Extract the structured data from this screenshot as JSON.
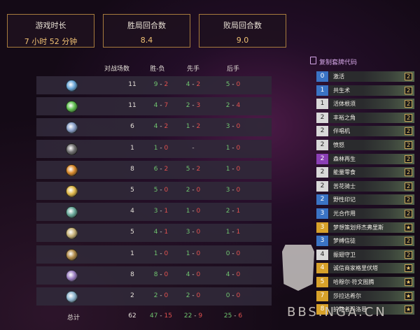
{
  "stats": [
    {
      "label": "游戏时长",
      "value": "7 小时 52 分钟"
    },
    {
      "label": "胜局回合数",
      "value": "8.4"
    },
    {
      "label": "败局回合数",
      "value": "9.0"
    }
  ],
  "table": {
    "headers": [
      "对战场数",
      "胜-负",
      "先手",
      "后手"
    ],
    "rows": [
      {
        "icon": "mage-class-icon",
        "color": "#6aa7d8",
        "games": "11",
        "wl": [
          "9",
          "2"
        ],
        "first": [
          "4",
          "2"
        ],
        "second": [
          "5",
          "0"
        ]
      },
      {
        "icon": "hunter-class-icon",
        "color": "#5fbf4f",
        "games": "11",
        "wl": [
          "4",
          "7"
        ],
        "first": [
          "2",
          "3"
        ],
        "second": [
          "2",
          "4"
        ]
      },
      {
        "icon": "shaman-class-icon",
        "color": "#8aa0c9",
        "games": "6",
        "wl": [
          "4",
          "2"
        ],
        "first": [
          "1",
          "2"
        ],
        "second": [
          "3",
          "0"
        ]
      },
      {
        "icon": "rogue-class-icon",
        "color": "#707070",
        "games": "1",
        "wl": [
          "1",
          "0"
        ],
        "first": [
          "-"
        ],
        "second": [
          "1",
          "0"
        ]
      },
      {
        "icon": "warrior-class-icon",
        "color": "#d98a2b",
        "games": "8",
        "wl": [
          "6",
          "2"
        ],
        "first": [
          "5",
          "2"
        ],
        "second": [
          "1",
          "0"
        ]
      },
      {
        "icon": "paladin-class-icon",
        "color": "#e1b94a",
        "games": "5",
        "wl": [
          "5",
          "0"
        ],
        "first": [
          "2",
          "0"
        ],
        "second": [
          "3",
          "0"
        ]
      },
      {
        "icon": "demon-hunter-class-icon",
        "color": "#68a89a",
        "games": "4",
        "wl": [
          "3",
          "1"
        ],
        "first": [
          "1",
          "0"
        ],
        "second": [
          "2",
          "1"
        ]
      },
      {
        "icon": "druid-class-icon",
        "color": "#c7b178",
        "games": "5",
        "wl": [
          "4",
          "1"
        ],
        "first": [
          "3",
          "0"
        ],
        "second": [
          "1",
          "1"
        ]
      },
      {
        "icon": "warlock-class-icon",
        "color": "#b08a4a",
        "games": "1",
        "wl": [
          "1",
          "0"
        ],
        "first": [
          "1",
          "0"
        ],
        "second": [
          "0",
          "0"
        ]
      },
      {
        "icon": "priest-class-icon",
        "color": "#9b7fc2",
        "games": "8",
        "wl": [
          "8",
          "0"
        ],
        "first": [
          "4",
          "0"
        ],
        "second": [
          "4",
          "0"
        ]
      },
      {
        "icon": "death-knight-class-icon",
        "color": "#8fb6cf",
        "games": "2",
        "wl": [
          "2",
          "0"
        ],
        "first": [
          "2",
          "0"
        ],
        "second": [
          "0",
          "0"
        ]
      }
    ],
    "total": {
      "label": "总计",
      "games": "62",
      "wl": [
        "47",
        "15"
      ],
      "first": [
        "22",
        "9"
      ],
      "second": [
        "25",
        "6"
      ]
    }
  },
  "deck": {
    "copy_label": "复制套牌代码",
    "cards": [
      {
        "cost": "0",
        "cost_color": "#3a73c4",
        "name": "激活",
        "count": "2"
      },
      {
        "cost": "1",
        "cost_color": "#3a73c4",
        "name": "共生术",
        "count": "2"
      },
      {
        "cost": "1",
        "cost_color": "#d9d9d9",
        "name": "活体根须",
        "count": "2"
      },
      {
        "cost": "2",
        "cost_color": "#d9d9d9",
        "name": "丰裕之角",
        "count": "2"
      },
      {
        "cost": "2",
        "cost_color": "#d9d9d9",
        "name": "伴唱机",
        "count": "2"
      },
      {
        "cost": "2",
        "cost_color": "#d9d9d9",
        "name": "愤怒",
        "count": "2"
      },
      {
        "cost": "2",
        "cost_color": "#8b3fb5",
        "name": "森林再生",
        "count": "2"
      },
      {
        "cost": "2",
        "cost_color": "#d9d9d9",
        "name": "能量零食",
        "count": "2"
      },
      {
        "cost": "2",
        "cost_color": "#d9d9d9",
        "name": "苦花骑士",
        "count": "2"
      },
      {
        "cost": "2",
        "cost_color": "#3a73c4",
        "name": "野性印记",
        "count": "2"
      },
      {
        "cost": "3",
        "cost_color": "#3a73c4",
        "name": "光合作用",
        "count": "2"
      },
      {
        "cost": "3",
        "cost_color": "#d7a12a",
        "name": "梦想策划师杰弗里斯",
        "count": "★"
      },
      {
        "cost": "3",
        "cost_color": "#3a73c4",
        "name": "梦缚信徒",
        "count": "2"
      },
      {
        "cost": "4",
        "cost_color": "#d9d9d9",
        "name": "振翅守卫",
        "count": "2"
      },
      {
        "cost": "4",
        "cost_color": "#d7a12a",
        "name": "诚信商家格里伏塔",
        "count": "★"
      },
      {
        "cost": "5",
        "cost_color": "#d7a12a",
        "name": "哈穆尔·符文图腾",
        "count": "★"
      },
      {
        "cost": "7",
        "cost_color": "#d7a12a",
        "name": "莎拉达希尔",
        "count": "★"
      },
      {
        "cost": "8",
        "cost_color": "#d7a12a",
        "name": "护路者玛洛恩",
        "count": "★"
      }
    ]
  },
  "watermark": "BBS.NGA.CN"
}
